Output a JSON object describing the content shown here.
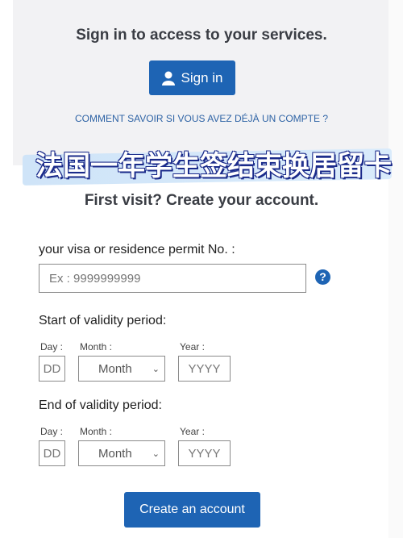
{
  "signin": {
    "title": "Sign in to access to your services.",
    "button": "Sign in",
    "icon": "user-icon",
    "link": "COMMENT SAVOIR SI VOUS AVEZ DÉJÀ UN COMPTE ?"
  },
  "overlay": {
    "text": "法国一年学生签结束换居留卡"
  },
  "register": {
    "title": "First visit? Create your account.",
    "permit_label": "your visa or residence permit No. :",
    "permit_placeholder": "Ex : 9999999999",
    "help_icon": "question-circle-icon",
    "start": {
      "label": "Start of validity period:",
      "day_label": "Day :",
      "month_label": "Month :",
      "year_label": "Year :",
      "day_placeholder": "DD",
      "month_value": "Month",
      "year_placeholder": "YYYY"
    },
    "end": {
      "label": "End of validity period:",
      "day_label": "Day :",
      "month_label": "Month :",
      "year_label": "Year :",
      "day_placeholder": "DD",
      "month_value": "Month",
      "year_placeholder": "YYYY"
    },
    "submit": "Create an account"
  },
  "colors": {
    "primary": "#1e64b4",
    "link": "#2e63a5"
  }
}
